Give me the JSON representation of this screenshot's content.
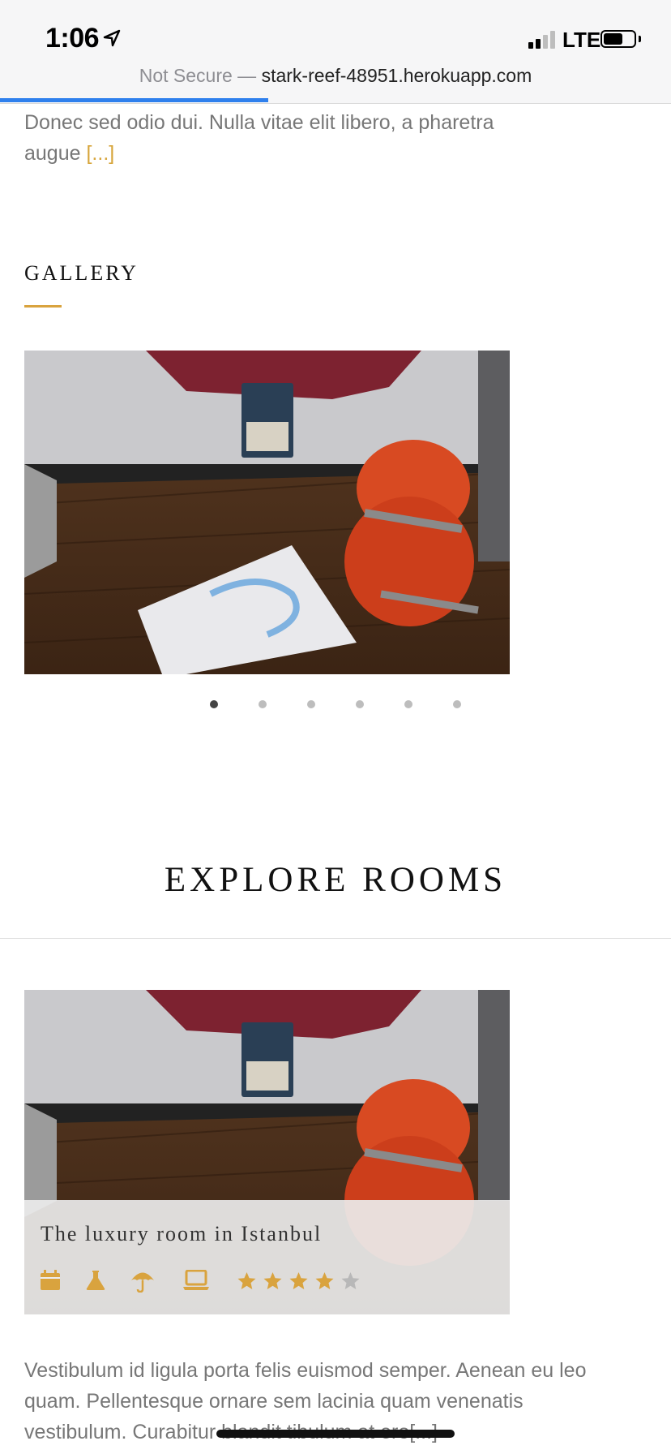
{
  "status_bar": {
    "time": "1:06",
    "network": "LTE",
    "location_icon": "location-arrow-icon",
    "battery_level": 0.65
  },
  "browser": {
    "security_label": "Not Secure —",
    "domain": "stark-reef-48951.herokuapp.com",
    "load_progress": 0.4
  },
  "intro": {
    "text": "Donec sed odio dui. Nulla vitae elit libero, a pharetra augue",
    "more_label": "[...]"
  },
  "gallery": {
    "title": "GALLERY",
    "slide_count": 6,
    "active_slide": 1
  },
  "rooms": {
    "section_title": "EXPLORE ROOMS",
    "room": {
      "title": "The luxury room in Istanbul",
      "amenities": [
        "calendar-icon",
        "flask-icon",
        "umbrella-icon",
        "laptop-icon"
      ],
      "rating": 4,
      "rating_max": 5,
      "description": "Vestibulum id ligula porta felis euismod semper. Aenean eu leo quam. Pellentesque ornare sem lacinia quam venenatis vestibulum. Curabitur blandit tibulum at ero[...]"
    }
  },
  "colors": {
    "accent_gold": "#d9a33e",
    "progress_blue": "#2f80ed",
    "text_gray": "#777777"
  }
}
